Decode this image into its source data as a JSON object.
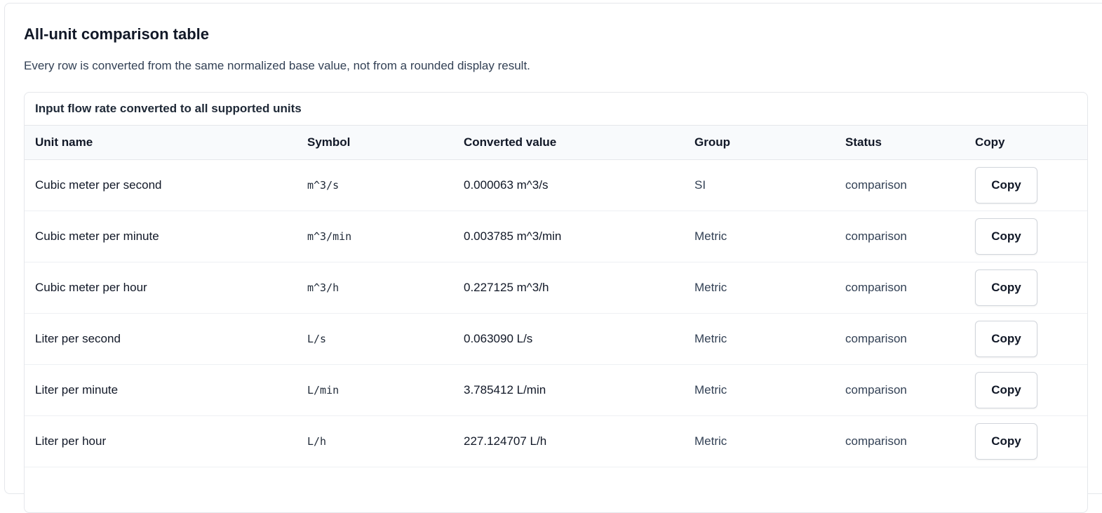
{
  "section": {
    "title": "All-unit comparison table",
    "description": "Every row is converted from the same normalized base value, not from a rounded display result."
  },
  "table": {
    "caption": "Input flow rate converted to all supported units",
    "headers": {
      "unit_name": "Unit name",
      "symbol": "Symbol",
      "converted_value": "Converted value",
      "group": "Group",
      "status": "Status",
      "copy": "Copy"
    },
    "rows": [
      {
        "unit_name": "Cubic meter per second",
        "symbol": "m^3/s",
        "converted_value": "0.000063 m^3/s",
        "group": "SI",
        "status": "comparison",
        "copy_label": "Copy"
      },
      {
        "unit_name": "Cubic meter per minute",
        "symbol": "m^3/min",
        "converted_value": "0.003785 m^3/min",
        "group": "Metric",
        "status": "comparison",
        "copy_label": "Copy"
      },
      {
        "unit_name": "Cubic meter per hour",
        "symbol": "m^3/h",
        "converted_value": "0.227125 m^3/h",
        "group": "Metric",
        "status": "comparison",
        "copy_label": "Copy"
      },
      {
        "unit_name": "Liter per second",
        "symbol": "L/s",
        "converted_value": "0.063090 L/s",
        "group": "Metric",
        "status": "comparison",
        "copy_label": "Copy"
      },
      {
        "unit_name": "Liter per minute",
        "symbol": "L/min",
        "converted_value": "3.785412 L/min",
        "group": "Metric",
        "status": "comparison",
        "copy_label": "Copy"
      },
      {
        "unit_name": "Liter per hour",
        "symbol": "L/h",
        "converted_value": "227.124707 L/h",
        "group": "Metric",
        "status": "comparison",
        "copy_label": "Copy"
      }
    ]
  }
}
